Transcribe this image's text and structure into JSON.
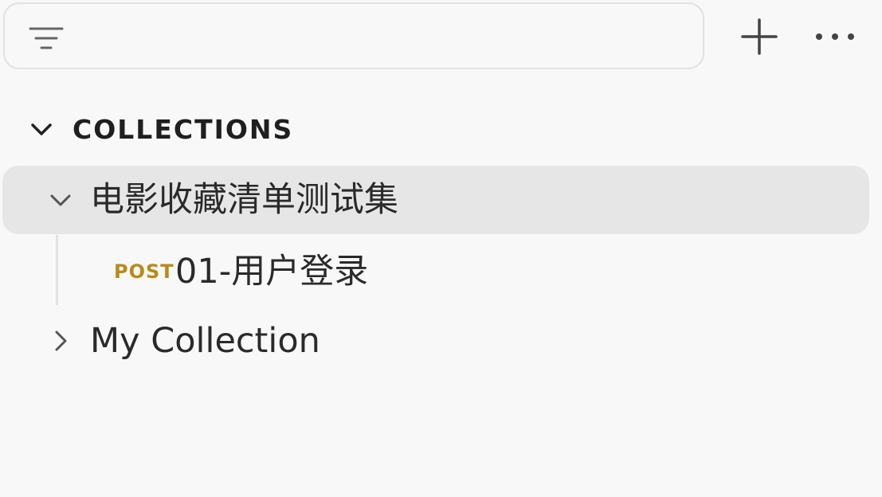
{
  "toolbar": {
    "filter_placeholder": "",
    "filter_icon": "filter-icon",
    "add_icon": "plus-icon",
    "more_icon": "more-horizontal-icon"
  },
  "section": {
    "title": "COLLECTIONS",
    "expanded": true,
    "chevron_icon": "chevron-down-icon"
  },
  "collections": [
    {
      "name": "电影收藏清单测试集",
      "expanded": true,
      "selected": true,
      "chevron_icon": "chevron-down-icon",
      "requests": [
        {
          "method": "POST",
          "name": "01-用户登录"
        }
      ]
    },
    {
      "name": "My Collection",
      "expanded": false,
      "selected": false,
      "chevron_icon": "chevron-right-icon",
      "requests": []
    }
  ],
  "colors": {
    "background": "#f8f8f8",
    "selected_row": "#e6e6e6",
    "post_method": "#b88a1a",
    "text": "#2a2a2a"
  }
}
